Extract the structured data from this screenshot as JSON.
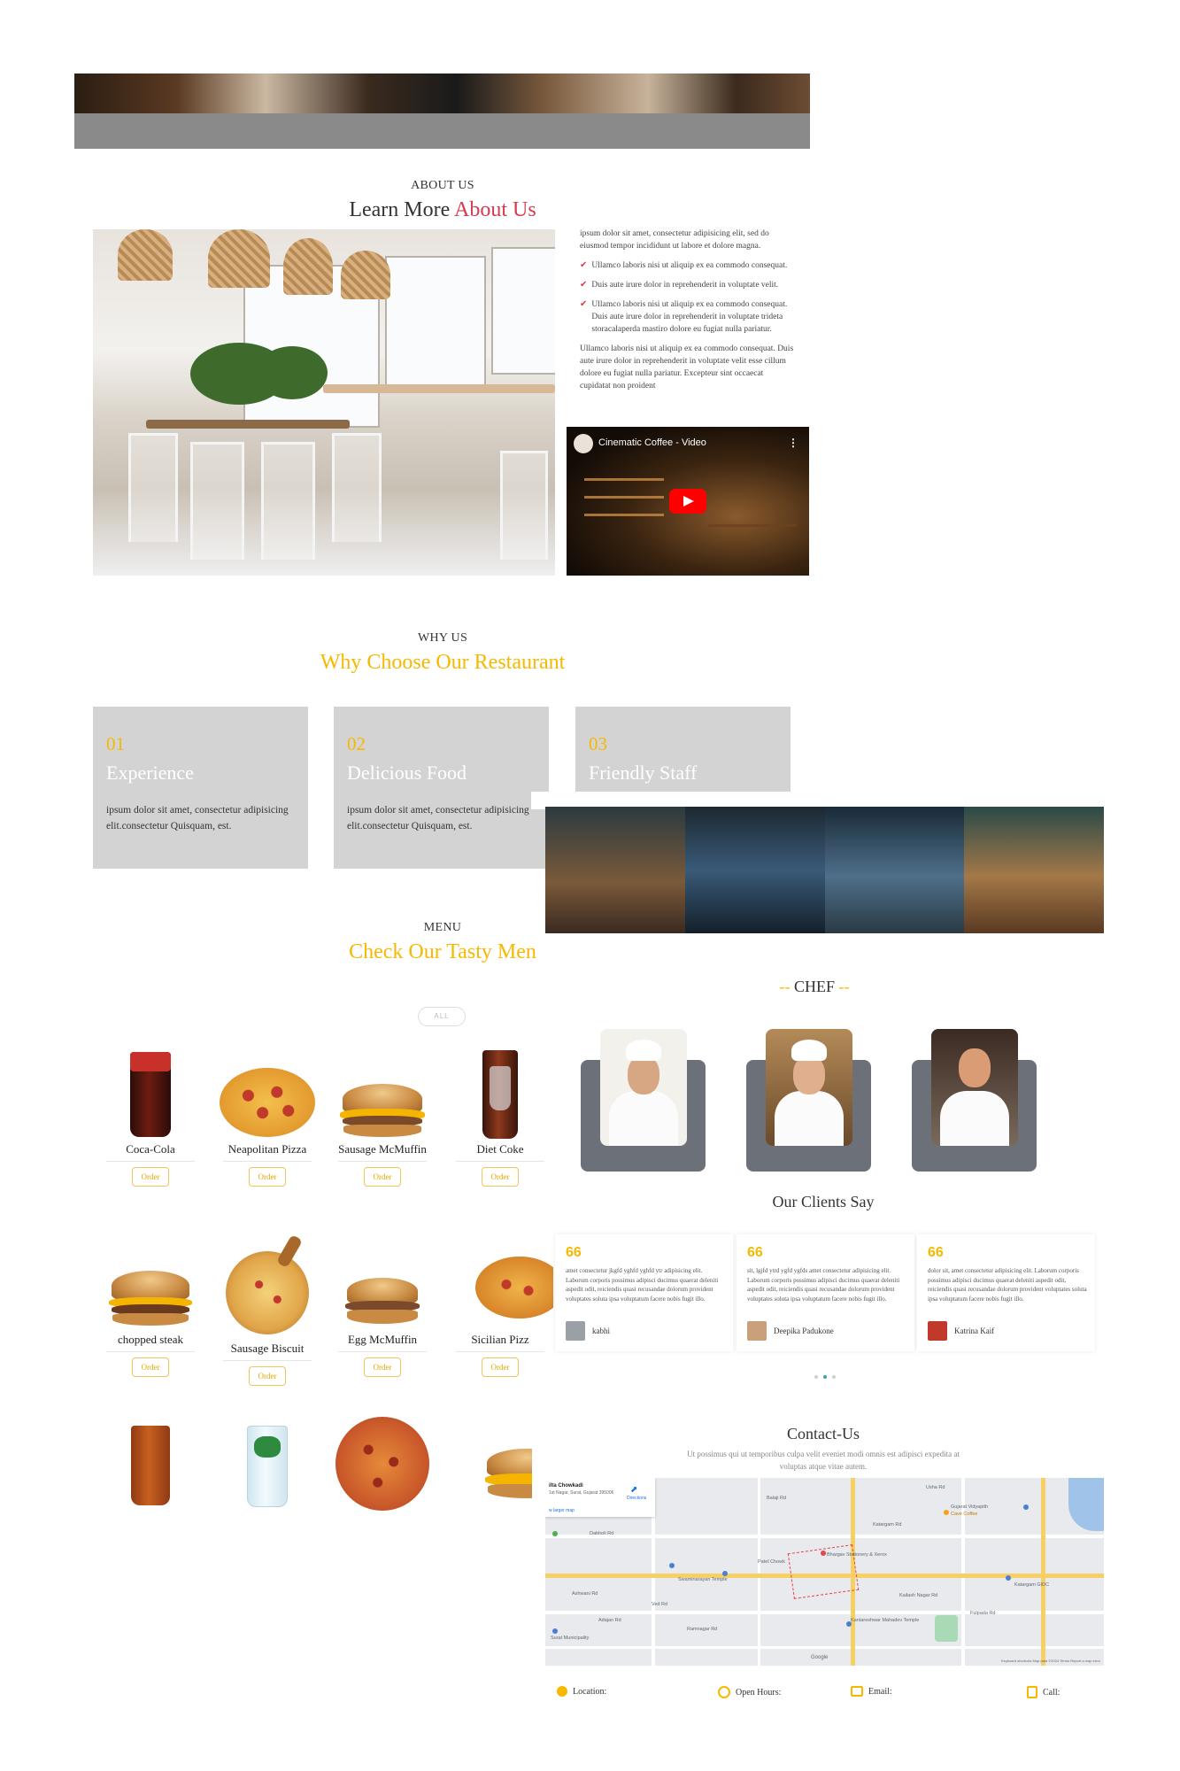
{
  "about": {
    "eyebrow": "ABOUT US",
    "title_plain": "Learn More",
    "title_accent": "About Us",
    "intro": "ipsum dolor sit amet, consectetur adipisicing elit, sed do eiusmod tempor incididunt ut labore et dolore magna.",
    "checks": [
      "Ullamco laboris nisi ut aliquip ex ea commodo consequat.",
      "Duis aute irure dolor in reprehenderit in voluptate velit.",
      "Ullamco laboris nisi ut aliquip ex ea commodo consequat. Duis aute irure dolor in reprehenderit in voluptate trideta storacalaperda mastiro dolore eu fugiat nulla pariatur."
    ],
    "outro": "Ullamco laboris nisi ut aliquip ex ea commodo consequat. Duis aute irure dolor in reprehenderit in voluptate velit esse cillum dolore eu fugiat nulla pariatur. Excepteur sint occaecat cupidatat non proident",
    "video_title": "Cinematic Coffee - Video"
  },
  "why": {
    "eyebrow": "WHY US",
    "title": "Why Choose Our Restaurant",
    "boxes": [
      {
        "num": "01",
        "title": "Experience",
        "desc": "ipsum dolor sit amet, consectetur adipisicing elit.consectetur Quisquam, est."
      },
      {
        "num": "02",
        "title": "Delicious Food",
        "desc": "ipsum dolor sit amet, consectetur adipisicing elit.consectetur Quisquam, est."
      },
      {
        "num": "03",
        "title": "Friendly Staff",
        "desc": ""
      }
    ]
  },
  "menu": {
    "eyebrow": "MENU",
    "title": "Check Our Tasty Men",
    "filter": "ALL",
    "order_label": "Order",
    "items": [
      {
        "name": "Coca-Cola"
      },
      {
        "name": "Neapolitan Pizza"
      },
      {
        "name": "Sausage McMuffin"
      },
      {
        "name": "Diet Coke"
      },
      {
        "name": "chopped steak"
      },
      {
        "name": "Sausage Biscuit"
      },
      {
        "name": "Egg McMuffin"
      },
      {
        "name": "Sicilian Pizz"
      }
    ]
  },
  "chef": {
    "title": "CHEF",
    "dash": "--"
  },
  "clients": {
    "title": "Our Clients Say",
    "quote_mark": "66",
    "cards": [
      {
        "text": "amet consectetur jkgfd yghfd yghfd ytr adipisicing elit. Laborum corporis possimus adipisci ducimus quaerat deleniti aspedit odit, reiciendis quasi recusandae dolorum provident voluptates soluta ipsa voluptatum facere nobis fugit illo.",
        "name": "kabhi"
      },
      {
        "text": "sit, lgjfd ytrd ygfd ygfds amet consectetur adipisicing elit. Laborum corporis possimus adipisci ducimus quaerat deleniti aspedit odit, reiciendis quasi recusandae dolorum provident voluptates soluta ipsa voluptatum facere nobis fugit illo.",
        "name": "Deepika Padukone"
      },
      {
        "text": "dolor sit, amet consectetur adipisicing elit. Laborum corporis possimus adipisci ducimus quaerat deleniti aspedit odit, reiciendis quasi recusandae dolorum provident voluptates soluta ipsa voluptatum facere nobis fugit illo.",
        "name": "Katrina Kaif"
      }
    ]
  },
  "contact": {
    "title": "Contact-Us",
    "subtitle": "Ut possimus qui ut temporibus culpa velit eveniet modi omnis est adipisci expedita at voluptas atque vitae autem.",
    "map": {
      "place": "ilta Chowkadi",
      "address": "1st Nagar, Surat, Gujarat 395006",
      "larger_map": "w larger map",
      "directions": "Directions",
      "google": "Google",
      "footer": "Keyboard shortcuts   Map data ©2024   Terms   Report a map error",
      "pois": [
        "Gujarat Vidyapith",
        "Cave Coffee",
        "Katargam GIDC",
        "Bhargav Stationery & Xerox",
        "Patel Chowk",
        "Swaminarayan Temple",
        "Kantareshwar Mahadev Temple",
        "Dabholi Rd",
        "Usha Rd",
        "Surat Municipality",
        "Fulpada Rd",
        "Ved Rd",
        "Balaji Rd",
        "Ashwani Rd",
        "Adajan Rd",
        "Katargam Rd",
        "Ramnagar Rd",
        "Kailash Nagar Rd"
      ]
    },
    "info": [
      {
        "label": "Location:"
      },
      {
        "label": "Open Hours:"
      },
      {
        "label": "Email:"
      },
      {
        "label": "Call:"
      }
    ]
  }
}
